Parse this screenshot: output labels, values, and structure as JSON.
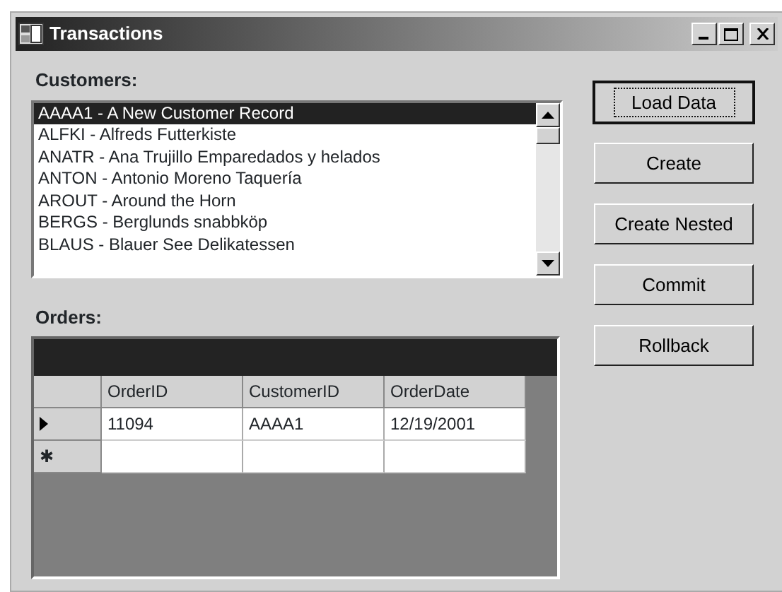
{
  "window": {
    "title": "Transactions"
  },
  "customers": {
    "label": "Customers:",
    "items": [
      {
        "text": "AAAA1 - A New Customer Record",
        "selected": true
      },
      {
        "text": "ALFKI - Alfreds Futterkiste",
        "selected": false
      },
      {
        "text": "ANATR - Ana Trujillo Emparedados y helados",
        "selected": false
      },
      {
        "text": "ANTON - Antonio Moreno Taquería",
        "selected": false
      },
      {
        "text": "AROUT - Around the Horn",
        "selected": false
      },
      {
        "text": "BERGS - Berglunds snabbköp",
        "selected": false
      },
      {
        "text": "BLAUS - Blauer See Delikatessen",
        "selected": false
      }
    ]
  },
  "buttons": [
    {
      "label": "Load Data",
      "focused": true
    },
    {
      "label": "Create",
      "focused": false
    },
    {
      "label": "Create Nested",
      "focused": false
    },
    {
      "label": "Commit",
      "focused": false
    },
    {
      "label": "Rollback",
      "focused": false
    }
  ],
  "orders": {
    "label": "Orders:",
    "columns": [
      "OrderID",
      "CustomerID",
      "OrderDate"
    ],
    "rows": [
      {
        "kind": "current",
        "cells": [
          "11094",
          "AAAA1",
          "12/19/2001"
        ]
      },
      {
        "kind": "new",
        "marker": "✱",
        "cells": [
          "",
          "",
          ""
        ]
      }
    ]
  }
}
